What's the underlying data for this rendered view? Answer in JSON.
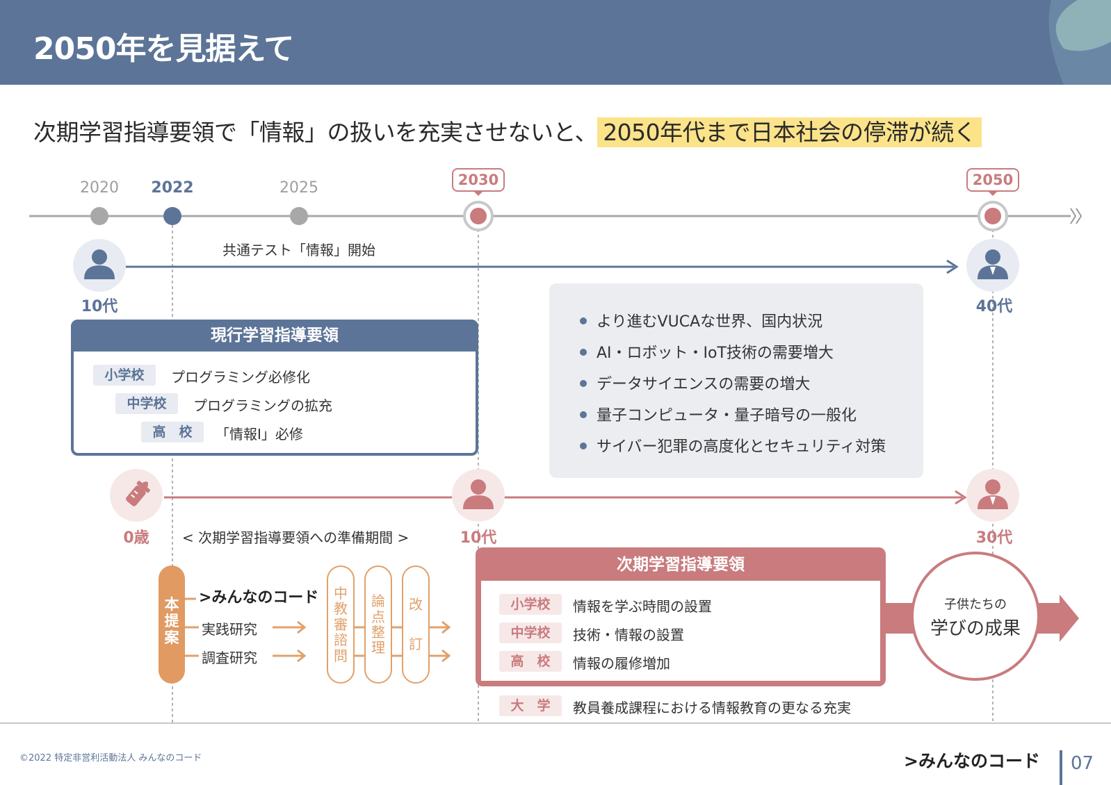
{
  "header": {
    "title": "2050年を見据えて"
  },
  "headline": {
    "text": "次期学習指導要領で「情報」の扱いを充実させないと、",
    "highlight": "2050年代まで日本社会の停滞が続く"
  },
  "timeline": {
    "years": [
      "2020",
      "2022",
      "2025",
      "2030",
      "2050"
    ],
    "event_label": "共通テスト「情報」開始"
  },
  "cohort_top": {
    "start_age": "10代",
    "end_age": "40代"
  },
  "cohort_bottom": {
    "start_age": "0歳",
    "mid_age": "10代",
    "end_age": "30代",
    "prep_label": "< 次期学習指導要領への準備期間 >"
  },
  "current_curriculum": {
    "title": "現行学習指導要領",
    "rows": [
      {
        "tag": "小学校",
        "text": "プログラミング必修化"
      },
      {
        "tag": "中学校",
        "text": "プログラミングの拡充"
      },
      {
        "tag": "高　校",
        "text": "「情報Ⅰ」必修"
      }
    ]
  },
  "trends": [
    "より進むVUCAな世界、国内状況",
    "AI・ロボット・IoT技術の需要増大",
    "データサイエンスの需要の増大",
    "量子コンピュータ・量子暗号の一般化",
    "サイバー犯罪の高度化とセキュリティ対策"
  ],
  "proposal": {
    "label": [
      "本",
      "提",
      "案"
    ],
    "logo": ">みんなのコード",
    "items": [
      "実践研究",
      "調査研究"
    ],
    "steps": [
      {
        "chars": [
          "中",
          "教",
          "審",
          "諮",
          "問"
        ]
      },
      {
        "chars": [
          "論",
          "点",
          "整",
          "理"
        ]
      },
      {
        "chars": [
          "改",
          "訂"
        ]
      }
    ]
  },
  "next_curriculum": {
    "title": "次期学習指導要領",
    "rows": [
      {
        "tag": "小学校",
        "text": "情報を学ぶ時間の設置"
      },
      {
        "tag": "中学校",
        "text": "技術・情報の設置"
      },
      {
        "tag": "高　校",
        "text": "情報の履修増加"
      }
    ],
    "extra": {
      "tag": "大　学",
      "text": "教員養成課程における情報教育の更なる充実"
    }
  },
  "result": {
    "small": "子供たちの",
    "big": "学びの成果"
  },
  "footer": {
    "copyright": "©2022 特定非営利活動法人 みんなのコード",
    "logo": ">みんなのコード",
    "page": "07"
  },
  "colors": {
    "blue": "#5c7497",
    "red": "#c97b7e",
    "orange": "#e0a16b",
    "highlight": "#fbe38a",
    "gray": "#9e9e9e"
  }
}
